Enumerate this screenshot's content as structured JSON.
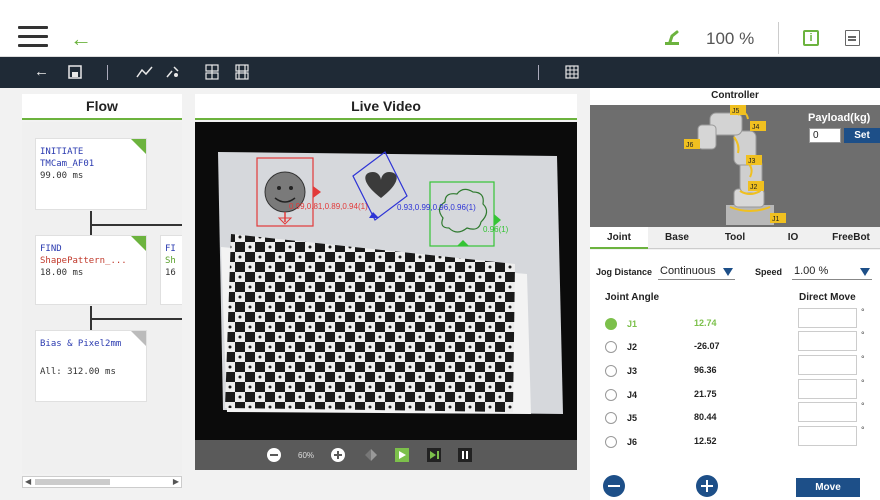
{
  "topbar": {
    "zoom": "100 %",
    "info_glyph": "i"
  },
  "flow": {
    "header": "Flow",
    "nodes": [
      {
        "line1": "INITIATE",
        "line2": "TMCam_AF01",
        "line3": "99.00 ms"
      },
      {
        "line1": "FIND",
        "line2": "ShapePattern_...",
        "line3": "18.00 ms"
      },
      {
        "line1": "FI",
        "line2": "Sh",
        "line3": "16"
      },
      {
        "line1": "Bias & Pixel2mm",
        "line2": "All: 312.00 ms"
      }
    ]
  },
  "live_video": {
    "header": "Live Video",
    "overlay_red": "0.99,0.81,0.89,0.94(1)",
    "overlay_blue": "0.93,0.99,0.96,0.96(1)",
    "overlay_green": "0.96(1)",
    "zoom": "60%"
  },
  "controller": {
    "header": "Controller",
    "payload_label": "Payload(kg)",
    "payload_value": "0",
    "set_label": "Set",
    "robot_labels": [
      "J5",
      "J4",
      "J6",
      "J3",
      "J2",
      "J1"
    ],
    "tabs": [
      "Joint",
      "Base",
      "Tool",
      "IO",
      "FreeBot"
    ],
    "jog_label": "Jog Distance",
    "jog_value": "Continuous",
    "speed_label": "Speed",
    "speed_value": "1.00 %",
    "joint_angle_label": "Joint Angle",
    "direct_move_label": "Direct Move",
    "joints": [
      {
        "name": "J1",
        "value": "12.74"
      },
      {
        "name": "J2",
        "value": "-26.07"
      },
      {
        "name": "J3",
        "value": "96.36"
      },
      {
        "name": "J4",
        "value": "21.75"
      },
      {
        "name": "J5",
        "value": "80.44"
      },
      {
        "name": "J6",
        "value": "12.52"
      }
    ],
    "degree_symbol": "°",
    "move_label": "Move"
  }
}
